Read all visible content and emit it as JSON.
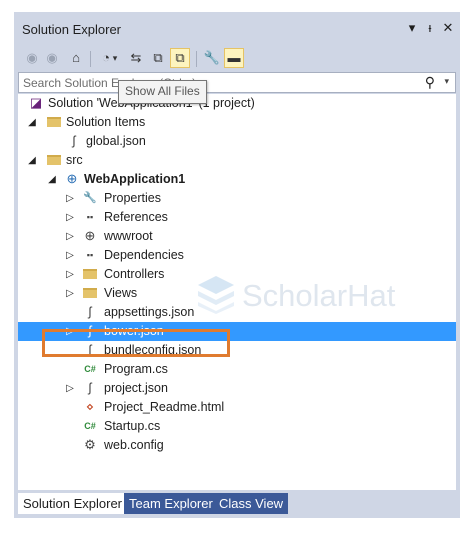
{
  "window": {
    "title": "Solution Explorer",
    "dropdown_glyph": "▾",
    "pin_glyph": "ᵻ",
    "close_glyph": "✕"
  },
  "toolbar": {
    "buttons": [
      "back-icon",
      "forward-icon",
      "home-icon",
      "history-icon",
      "sync-icon",
      "collapse-all-icon",
      "show-all-files-icon",
      "properties-icon",
      "preview-icon"
    ],
    "glyphs": {
      "back": "◉",
      "forward": "◉",
      "home": "⌂",
      "history": "◔",
      "history_dd": "▾",
      "sync": "⇆",
      "collapse": "⧉",
      "show_all": "⧉",
      "props": "🔧",
      "preview": "▬"
    }
  },
  "search": {
    "placeholder": "Search Solution Explorer (Ctrl+;)",
    "icon_glyph": "⚲",
    "dropdown_glyph": "▾"
  },
  "tooltip": {
    "text": "Show All Files"
  },
  "tree": {
    "expander_open": "◢",
    "expander_closed": "▷",
    "items": [
      {
        "label": "Solution 'WebApplication1' (1 project)",
        "icon": "solution-icon",
        "glyph": "◪"
      },
      {
        "label": "Solution Items",
        "icon": "folder-icon"
      },
      {
        "label": "global.json",
        "icon": "json-file-icon",
        "glyph": "ʃ"
      },
      {
        "label": "src",
        "icon": "folder-icon"
      },
      {
        "label": "WebApplication1",
        "icon": "web-project-icon",
        "glyph": "⊕"
      },
      {
        "label": "Properties",
        "icon": "wrench-icon",
        "glyph": "🔧"
      },
      {
        "label": "References",
        "icon": "references-icon",
        "glyph": "▪▪"
      },
      {
        "label": "wwwroot",
        "icon": "globe-icon",
        "glyph": "⊕"
      },
      {
        "label": "Dependencies",
        "icon": "dependencies-icon",
        "glyph": "▪▪"
      },
      {
        "label": "Controllers",
        "icon": "folder-icon"
      },
      {
        "label": "Views",
        "icon": "folder-icon"
      },
      {
        "label": "appsettings.json",
        "icon": "json-file-icon",
        "glyph": "ʃ"
      },
      {
        "label": "bower.json",
        "icon": "json-file-icon",
        "glyph": "ʃ"
      },
      {
        "label": "bundleconfig.json",
        "icon": "json-file-icon",
        "glyph": "ʃ"
      },
      {
        "label": "Program.cs",
        "icon": "csharp-file-icon",
        "glyph": "C#"
      },
      {
        "label": "project.json",
        "icon": "json-file-icon",
        "glyph": "ʃ"
      },
      {
        "label": "Project_Readme.html",
        "icon": "html-file-icon",
        "glyph": "⋄"
      },
      {
        "label": "Startup.cs",
        "icon": "csharp-file-icon",
        "glyph": "C#"
      },
      {
        "label": "web.config",
        "icon": "config-file-icon",
        "glyph": "⚙"
      }
    ],
    "selected_item": "bower.json"
  },
  "watermark": {
    "text": "ScholarHat"
  },
  "tabs": [
    {
      "label": "Solution Explorer",
      "active": true
    },
    {
      "label": "Team Explorer",
      "active": false
    },
    {
      "label": "Class View",
      "active": false
    }
  ],
  "colors": {
    "chrome": "#cfd6e5",
    "selection": "#3399ff",
    "highlight_box": "#e07b2f",
    "inactive_tab": "#3b5998"
  }
}
